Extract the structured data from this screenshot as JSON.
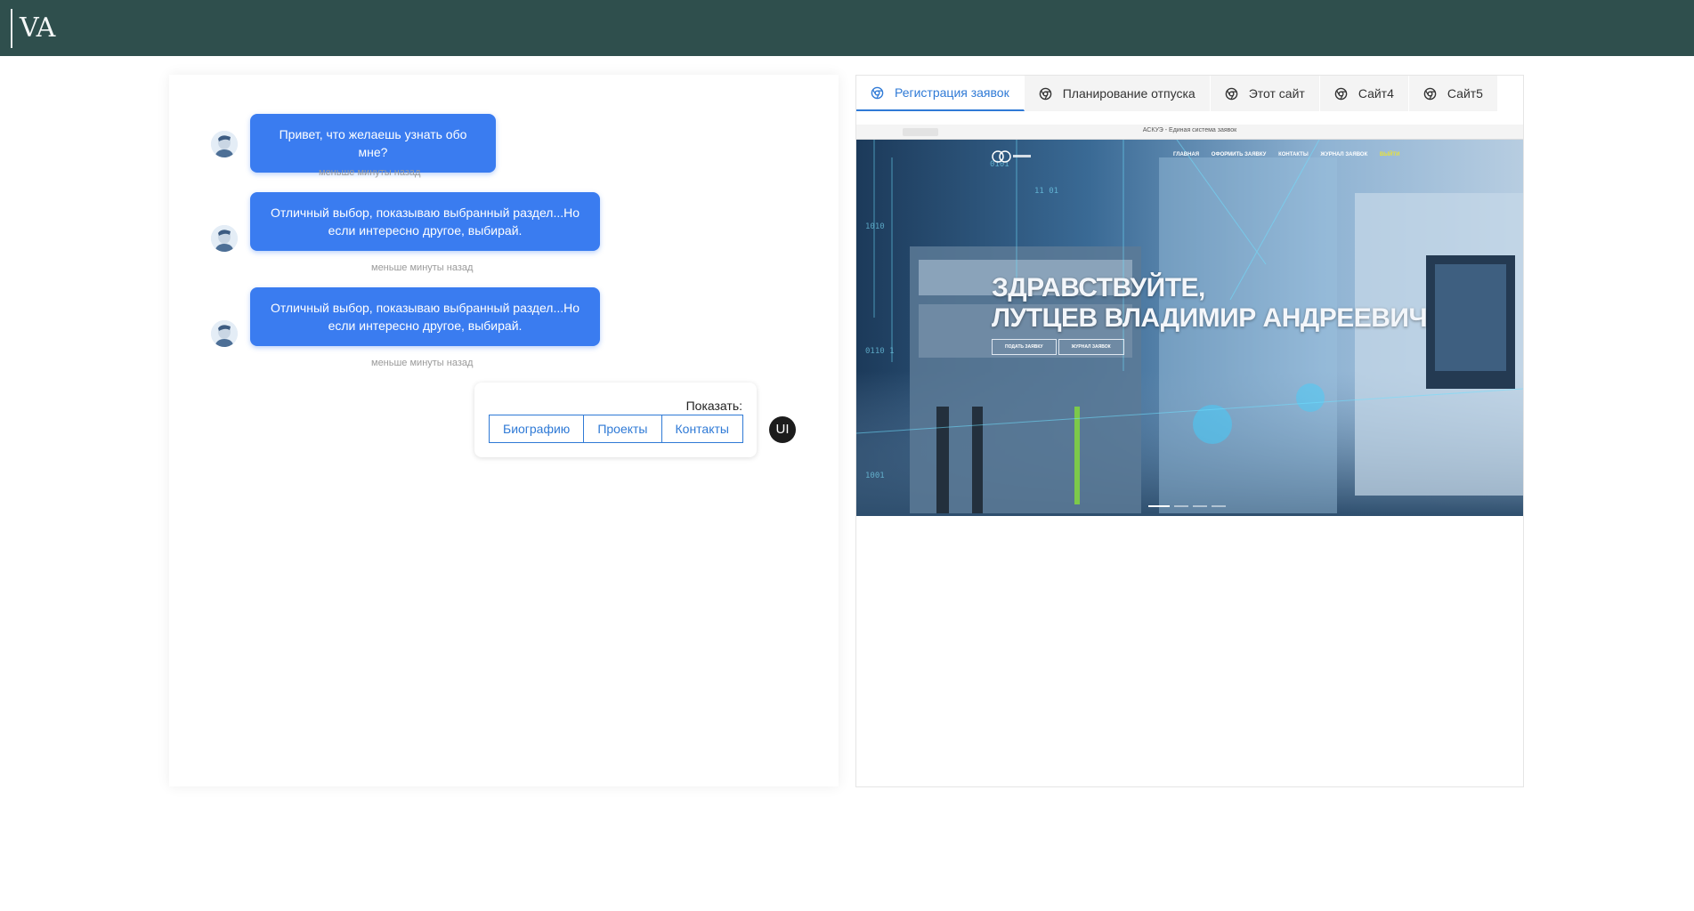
{
  "header": {
    "logo": "VA",
    "bg_color": "#2f4f4d"
  },
  "chat": {
    "messages": [
      {
        "text": "Привет, что желаешь узнать обо мне?",
        "time": "меньше минуты назад"
      },
      {
        "text": "Отличный выбор, показываю выбранный раздел...Но если интересно другое, выбирай.",
        "time": "меньше минуты назад"
      },
      {
        "text": "Отличный выбор, показываю выбранный раздел...Но если интересно другое, выбирай.",
        "time": "меньше минуты назад"
      }
    ],
    "bubble_color": "#3a7cf0",
    "choice": {
      "label": "Показать:",
      "buttons": [
        "Биографию",
        "Проекты",
        "Контакты"
      ]
    },
    "user_avatar": "UI"
  },
  "site_viewer": {
    "accent_color": "#2f7ad6",
    "tabs": [
      {
        "label": "Регистрация заявок",
        "active": true
      },
      {
        "label": "Планирование отпуска",
        "active": false
      },
      {
        "label": "Этот сайт",
        "active": false
      },
      {
        "label": "Сайт4",
        "active": false
      },
      {
        "label": "Сайт5",
        "active": false
      }
    ],
    "preview": {
      "browser_title": "АСКУЭ - Единая система заявок",
      "nav": [
        "ГЛАВНАЯ",
        "ОФОРМИТЬ ЗАЯВКУ",
        "КОНТАКТЫ",
        "ЖУРНАЛ ЗАЯВОК",
        "ВЫЙТИ"
      ],
      "greeting_line1": "ЗДРАВСТВУЙТЕ,",
      "greeting_line2": "ЛУТЦЕВ ВЛАДИМИР АНДРЕЕВИЧ",
      "buttons": [
        "ПОДАТЬ ЗАЯВКУ",
        "ЖУРНАЛ ЗАЯВОК"
      ]
    }
  }
}
